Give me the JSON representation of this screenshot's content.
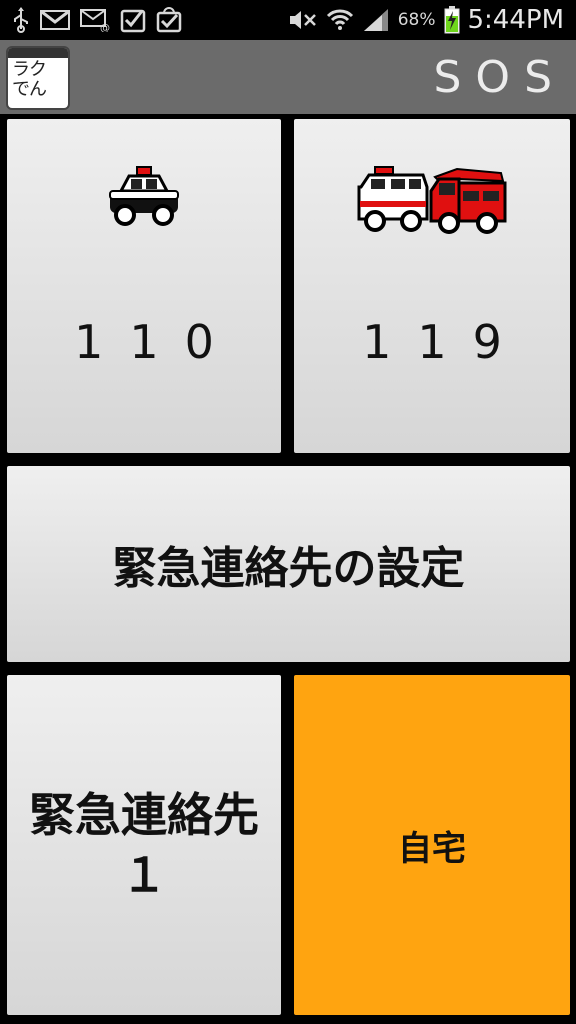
{
  "status_bar": {
    "icons_left": [
      "usb-icon",
      "gmail-icon",
      "email-icon",
      "check-download-icon",
      "check-store-icon"
    ],
    "icons_right": [
      "mute-icon",
      "wifi-icon",
      "signal-icon",
      "battery-charging-icon"
    ],
    "battery": "68%",
    "time": "5:44PM"
  },
  "action_bar": {
    "app_logo_text": "ラク\nでん",
    "title": "SOS"
  },
  "tiles": {
    "police": {
      "number": "110",
      "icon": "police-car-icon"
    },
    "ambulance_fire": {
      "number": "119",
      "icon": "ambulance-firetruck-icon"
    },
    "settings": {
      "label": "緊急連絡先の設定"
    },
    "contact1": {
      "label": "緊急連絡先１"
    },
    "home": {
      "label": "自宅",
      "color": "#ffa410"
    }
  }
}
